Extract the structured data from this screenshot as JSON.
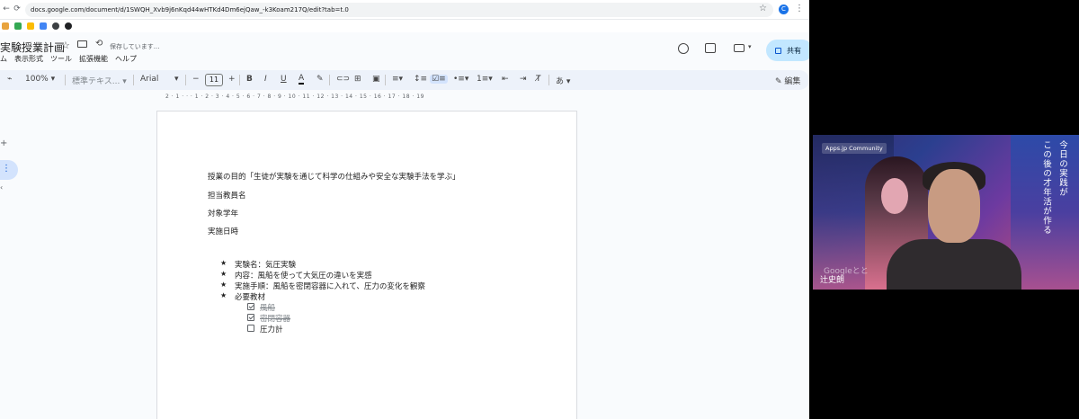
{
  "browser": {
    "url": "docs.google.com/document/d/1SWQH_Xvb9j6nKqd44wHTKd4Dm6ejQaw_-k3Koam217Q/edit?tab=t.0",
    "profile_initial": "C"
  },
  "docs": {
    "title": "実験授業計画",
    "saving_status": "保存しています...",
    "menu": [
      "ム",
      "表示形式",
      "ツール",
      "拡張機能",
      "ヘルプ"
    ],
    "share_label": "共有",
    "editing_label": "編集",
    "toolbar": {
      "zoom": "100%",
      "style": "標準テキス...",
      "font": "Arial",
      "font_size": "11",
      "minus": "−",
      "plus": "+",
      "bold": "B",
      "italic": "I",
      "underline": "U",
      "text_color": "A",
      "input_tools": "あ"
    },
    "ruler_text": "2 · 1 · · · 1 · 2 · 3 · 4 · 5 · 6 · 7 · 8 · 9 · 10 · 11 · 12 · 13 · 14 · 15 · 16 · 17 · 18 · 19"
  },
  "document": {
    "purpose": "授業の目的「生徒が実験を通じて科学の仕組みや安全な実験手法を学ぶ」",
    "teacher": "担当教員名",
    "grade": "対象学年",
    "date": "実施日時",
    "bullet_char": "★",
    "bullets": [
      "実験名：気圧実験",
      "内容：風船を使って大気圧の違いを実感",
      "実施手順：風船を密閉容器に入れて、圧力の変化を観察",
      "必要教材"
    ],
    "checklist": [
      {
        "text": "風船",
        "done": true
      },
      {
        "text": "密閉容器",
        "done": true
      },
      {
        "text": "圧力計",
        "done": false
      }
    ]
  },
  "video": {
    "community_badge": "Apps.jp Community",
    "vertical_lines": [
      "今日の実践が",
      "この後の才年活が作る"
    ],
    "watermark": "Googleとと",
    "speaker_name": "辻史朗"
  }
}
